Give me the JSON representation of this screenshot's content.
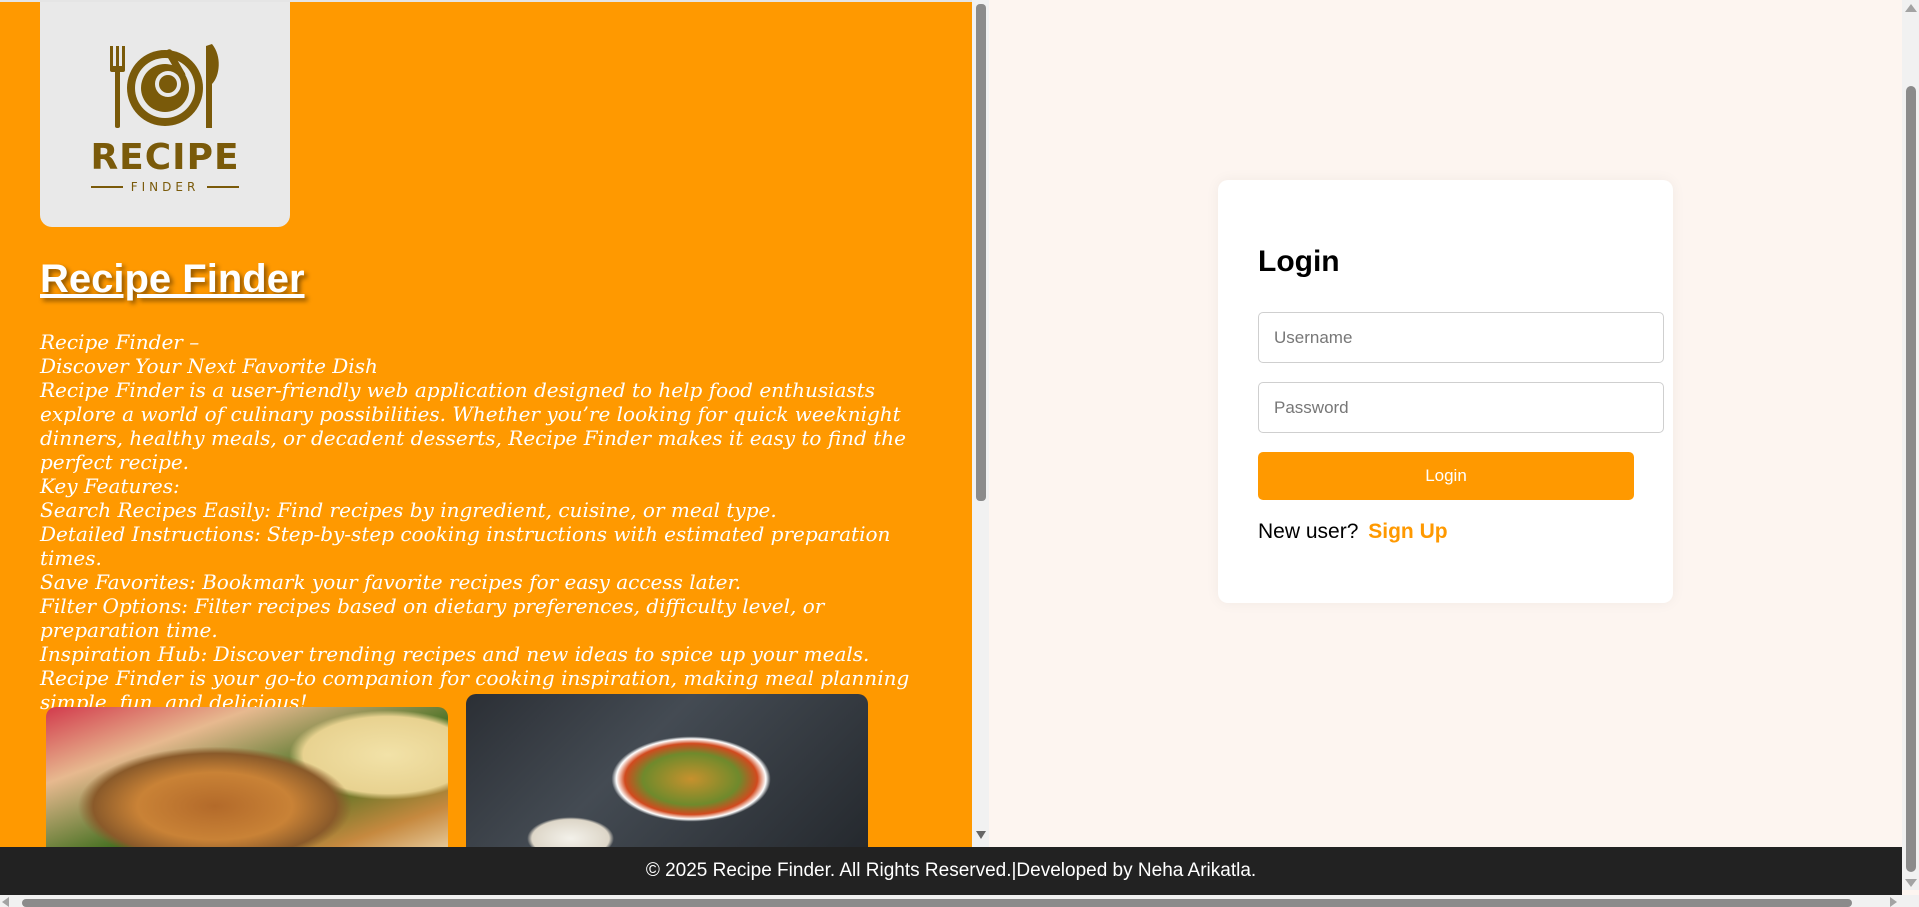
{
  "brand": {
    "logo_word": "RECIPE",
    "logo_sub": "FINDER",
    "logo_color": "#7a5a0a",
    "panel_color": "#ff9900"
  },
  "hero": {
    "title": "Recipe Finder",
    "lines": [
      "Recipe Finder –",
      "Discover Your Next Favorite Dish",
      "Recipe Finder is a user-friendly web application designed to help food enthusiasts explore a world of culinary possibilities. Whether you’re looking for quick weeknight dinners, healthy meals, or decadent desserts, Recipe Finder makes it easy to find the perfect recipe.",
      "Key Features:",
      "Search Recipes Easily: Find recipes by ingredient, cuisine, or meal type.",
      "Detailed Instructions: Step-by-step cooking instructions with estimated preparation times.",
      "Save Favorites: Bookmark your favorite recipes for easy access later.",
      "Filter Options: Filter recipes based on dietary preferences, difficulty level, or preparation time.",
      "Inspiration Hub: Discover trending recipes and new ideas to spice up your meals.",
      "Recipe Finder is your go-to companion for cooking inspiration, making meal planning simple, fun, and delicious!"
    ]
  },
  "login": {
    "heading": "Login",
    "username_placeholder": "Username",
    "username_value": "",
    "password_placeholder": "Password",
    "password_value": "",
    "button_label": "Login",
    "new_user_text": "New user?",
    "signup_label": "Sign Up",
    "accent_color": "#ff9900"
  },
  "footer": {
    "text": "© 2025 Recipe Finder. All Rights Reserved.|Developed by Neha Arikatla."
  }
}
